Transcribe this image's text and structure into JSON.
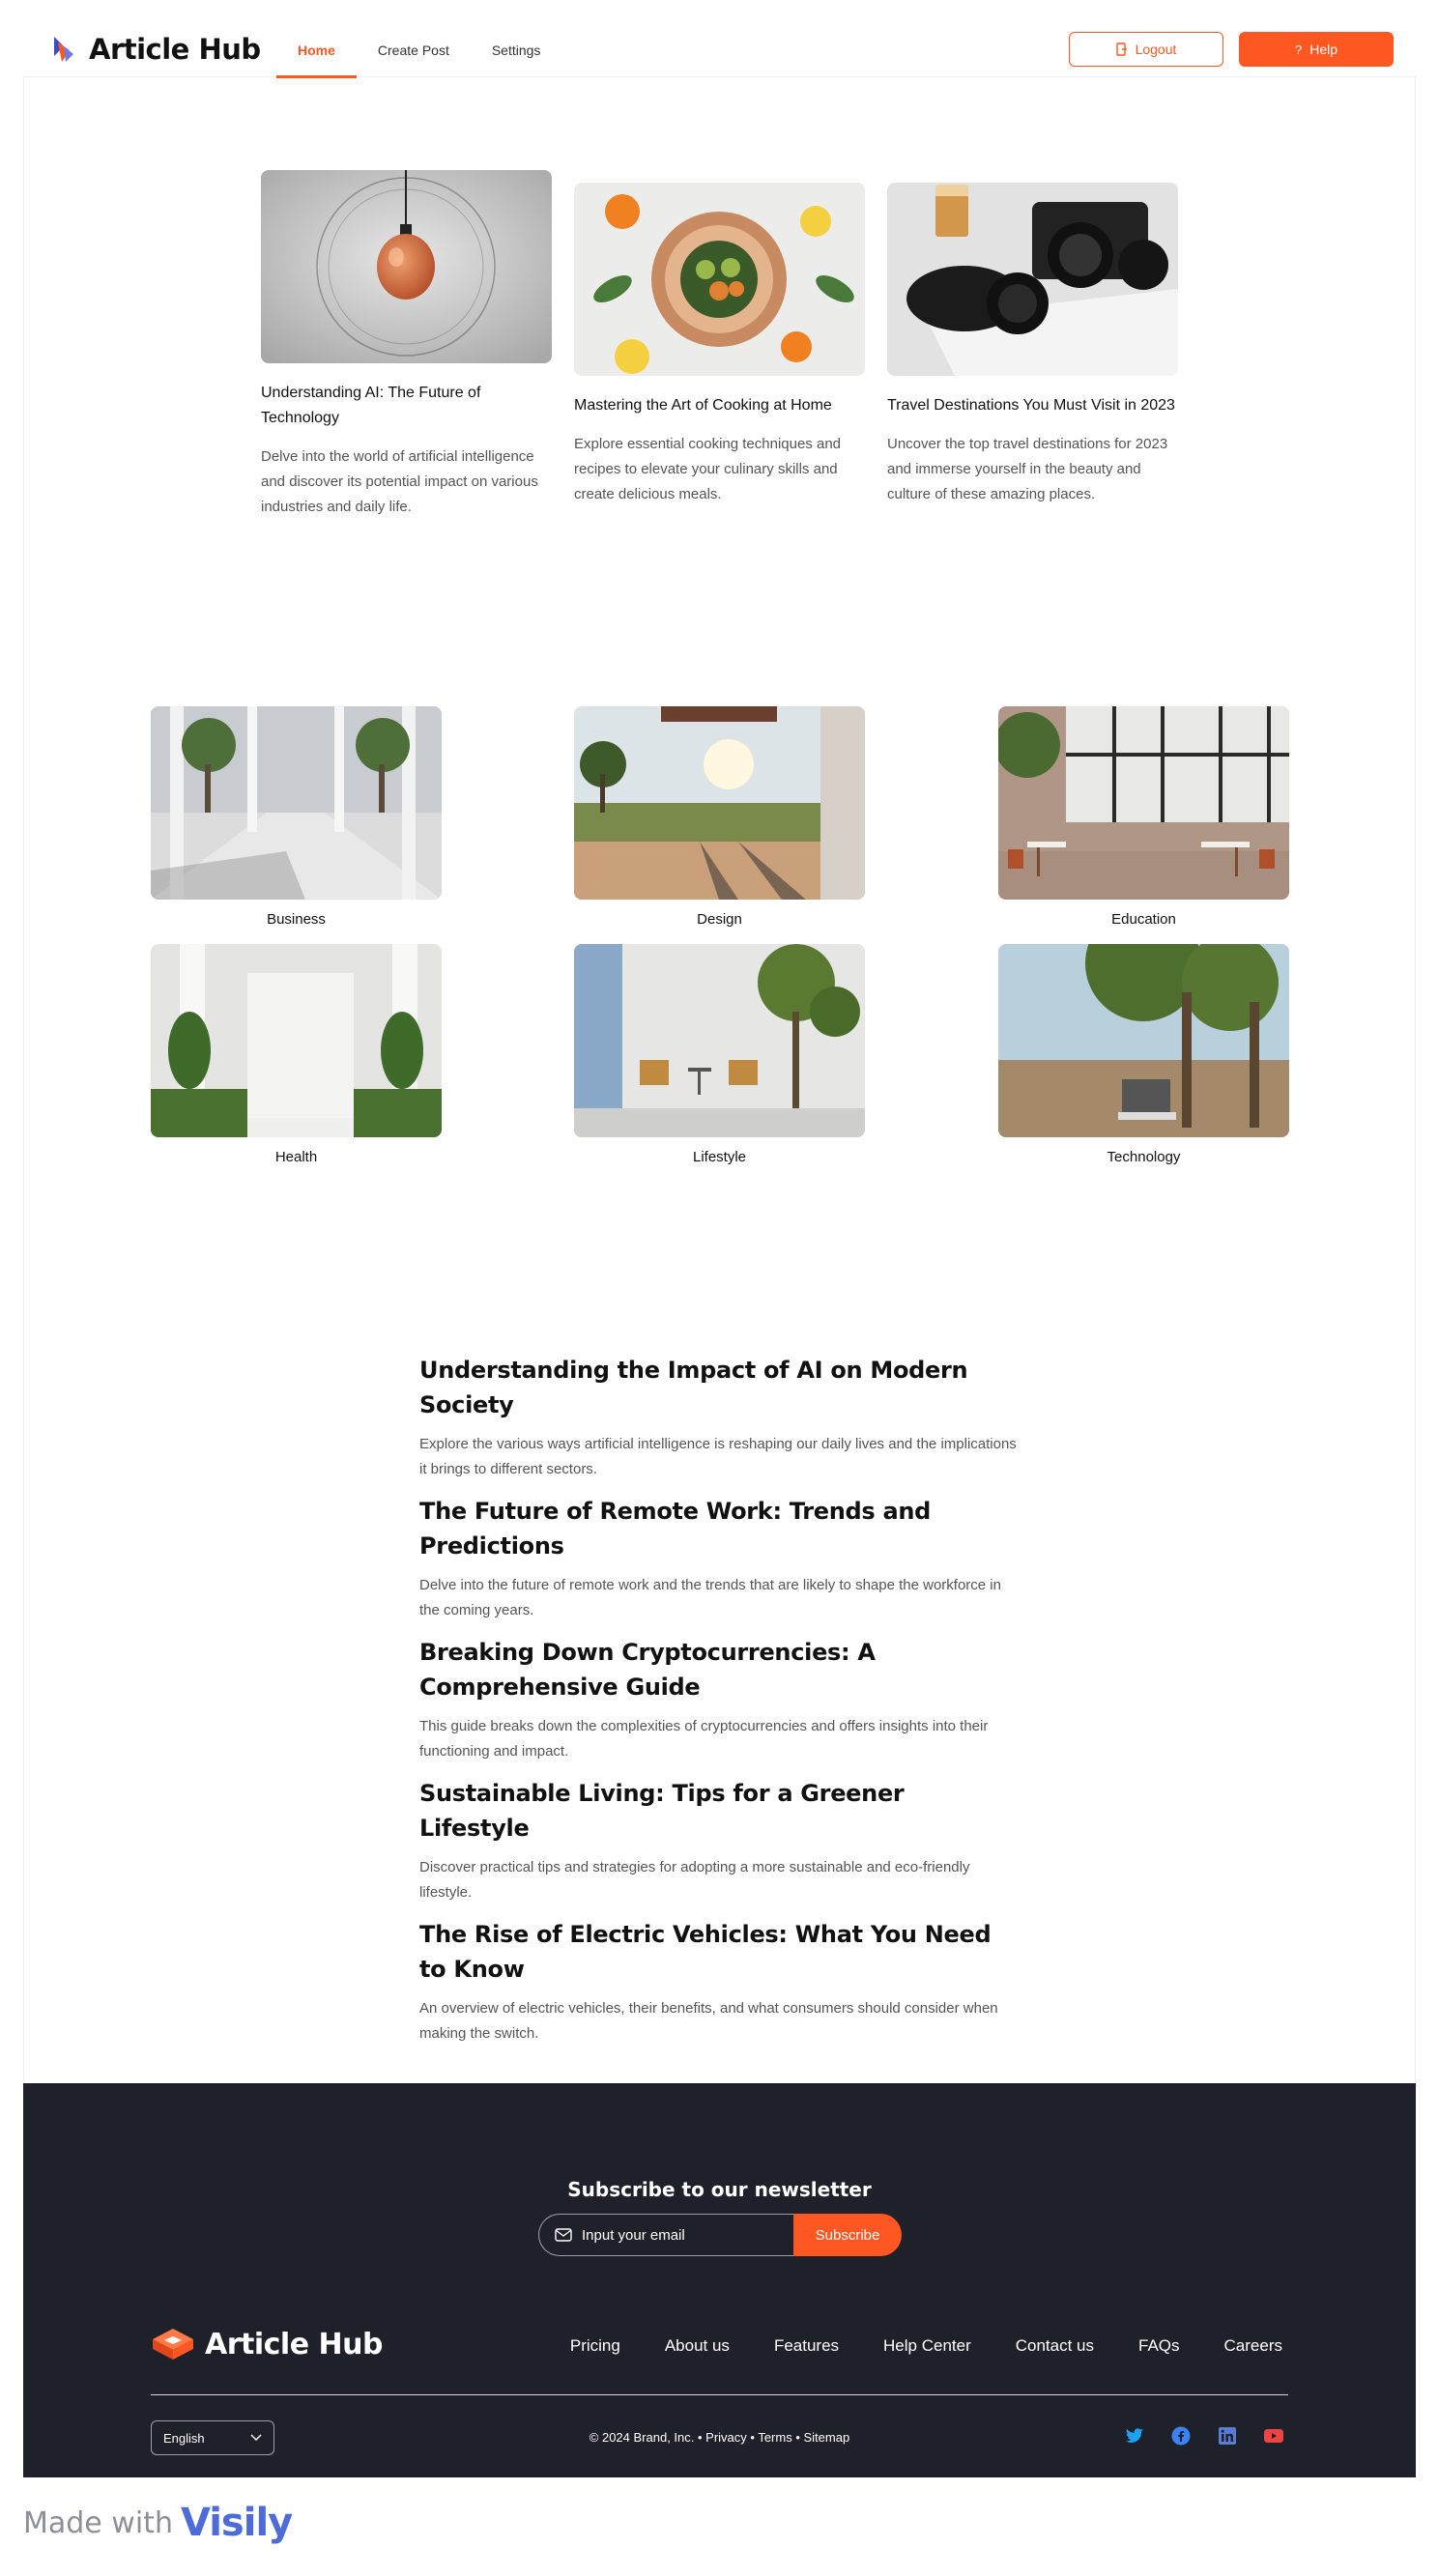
{
  "brand": {
    "name": "Article Hub",
    "accent": "#ff5722"
  },
  "nav": {
    "items": [
      {
        "label": "Home",
        "active": true
      },
      {
        "label": "Create Post",
        "active": false
      },
      {
        "label": "Settings",
        "active": false
      }
    ],
    "logout_label": "Logout",
    "help_label": "Help"
  },
  "featured": [
    {
      "title": "Understanding AI: The Future of Technology",
      "description": "Delve into the world of artificial intelligence and discover its potential impact on various industries and daily life.",
      "image": "pendant-lamp"
    },
    {
      "title": "Mastering the Art of Cooking at Home",
      "description": "Explore essential cooking techniques and recipes to elevate your culinary skills and create delicious meals.",
      "image": "food-bowl"
    },
    {
      "title": "Travel Destinations You Must Visit in 2023",
      "description": "Uncover the top travel destinations for 2023 and immerse yourself in the beauty and culture of these amazing places.",
      "image": "camera"
    }
  ],
  "categories": [
    {
      "label": "Business",
      "image": "courtyard-columns"
    },
    {
      "label": "Design",
      "image": "open-field-view"
    },
    {
      "label": "Education",
      "image": "cafe-interior"
    },
    {
      "label": "Health",
      "image": "white-wall-garden"
    },
    {
      "label": "Lifestyle",
      "image": "patio-chairs-tree"
    },
    {
      "label": "Technology",
      "image": "laptop-under-tree"
    }
  ],
  "articles": [
    {
      "title": "Understanding the Impact of AI on Modern Society",
      "summary": "Explore the various ways artificial intelligence is reshaping our daily lives and the implications it brings to different sectors."
    },
    {
      "title": "The Future of Remote Work: Trends and Predictions",
      "summary": "Delve into the future of remote work and the trends that are likely to shape the workforce in the coming years."
    },
    {
      "title": "Breaking Down Cryptocurrencies: A Comprehensive Guide",
      "summary": "This guide breaks down the complexities of cryptocurrencies and offers insights into their functioning and impact."
    },
    {
      "title": "Sustainable Living: Tips for a Greener Lifestyle",
      "summary": "Discover practical tips and strategies for adopting a more sustainable and eco-friendly lifestyle."
    },
    {
      "title": "The Rise of Electric Vehicles: What You Need to Know",
      "summary": "An overview of electric vehicles, their benefits, and what consumers should consider when making the switch."
    }
  ],
  "footer": {
    "newsletter_title": "Subscribe to our newsletter",
    "email_placeholder": "Input your email",
    "subscribe_label": "Subscribe",
    "brand": "Article Hub",
    "links": [
      "Pricing",
      "About us",
      "Features",
      "Help Center",
      "Contact us",
      "FAQs",
      "Careers"
    ],
    "language": "English",
    "copyright": "© 2024 Brand, Inc.",
    "legal_links": [
      "Privacy",
      "Terms",
      "Sitemap"
    ],
    "social": [
      {
        "icon": "twitter-icon",
        "color": "#1da1f2"
      },
      {
        "icon": "facebook-icon",
        "color": "#3b82f6"
      },
      {
        "icon": "linkedin-icon",
        "color": "#5a7bd6"
      },
      {
        "icon": "youtube-icon",
        "color": "#ef4444"
      }
    ],
    "bg": "#1e2129"
  },
  "made_with": {
    "text": "Made with",
    "brand": "Visily"
  }
}
